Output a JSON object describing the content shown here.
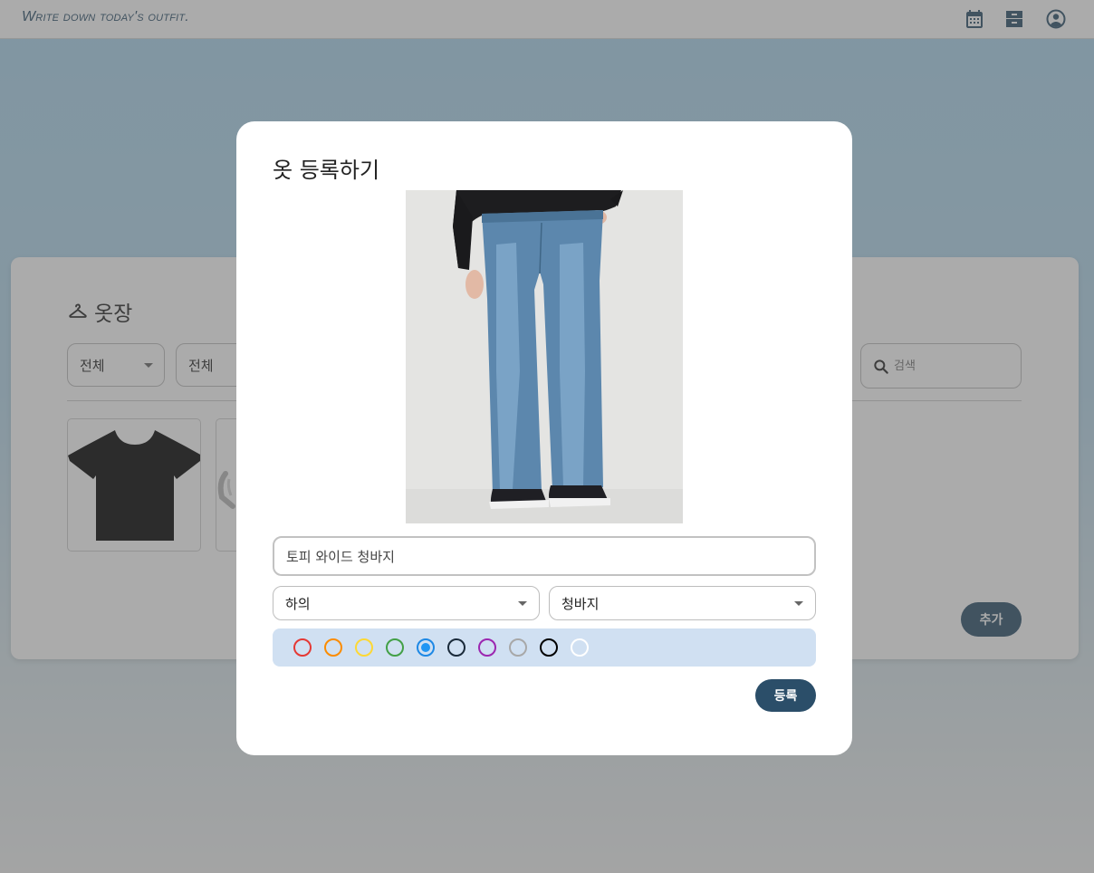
{
  "header": {
    "brand": "Write down today's outfit.",
    "icons": [
      "calendar-icon",
      "archive-box-icon",
      "account-circle-icon"
    ]
  },
  "wardrobe": {
    "title": "옷장",
    "title_icon": "hanger-icon",
    "category_filter": "전체",
    "subcategory_filter": "전체",
    "search_placeholder": "검색",
    "add_label": "추가"
  },
  "modal": {
    "title": "옷 등록하기",
    "name_value": "토피 와이드 청바지",
    "category": "하의",
    "subcategory": "청바지",
    "colors": [
      {
        "name": "red",
        "hex": "#e53935"
      },
      {
        "name": "orange",
        "hex": "#fb8c00"
      },
      {
        "name": "yellow",
        "hex": "#fdd835"
      },
      {
        "name": "green",
        "hex": "#43a047"
      },
      {
        "name": "blue",
        "hex": "#1e88e5"
      },
      {
        "name": "navy",
        "hex": "#1a2a3a"
      },
      {
        "name": "purple",
        "hex": "#9c27b0"
      },
      {
        "name": "gray",
        "hex": "#a8a8a8"
      },
      {
        "name": "black",
        "hex": "#000000"
      },
      {
        "name": "white",
        "hex": "#ffffff"
      }
    ],
    "selected_color": "blue",
    "submit_label": "등록"
  },
  "theme": {
    "accent": "#2b4e69"
  }
}
